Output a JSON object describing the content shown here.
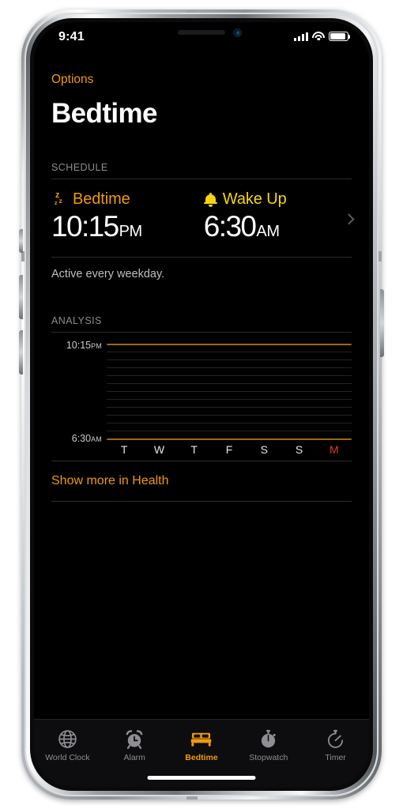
{
  "status_bar": {
    "time": "9:41",
    "signal_icon": "cellular-signal-icon",
    "wifi_icon": "wifi-icon",
    "battery_icon": "battery-full-icon"
  },
  "nav": {
    "options_label": "Options",
    "title": "Bedtime"
  },
  "schedule": {
    "header": "SCHEDULE",
    "bedtime": {
      "icon": "zzz-sleep-icon",
      "label": "Bedtime",
      "time": "10:15",
      "meridiem": "PM",
      "color": "#f09a0a"
    },
    "wakeup": {
      "icon": "bell-icon",
      "label": "Wake Up",
      "time": "6:30",
      "meridiem": "AM",
      "color": "#f7d411"
    },
    "disclosure_icon": "chevron-right-icon",
    "note": "Active every weekday."
  },
  "analysis": {
    "header": "ANALYSIS",
    "top_label_time": "10:15",
    "top_label_meridiem": "PM",
    "bottom_label_time": "6:30",
    "bottom_label_meridiem": "AM",
    "health_link": "Show more in Health"
  },
  "chart_data": {
    "type": "bar",
    "title": "ANALYSIS",
    "xlabel": "",
    "ylabel": "",
    "categories": [
      "T",
      "W",
      "T",
      "F",
      "S",
      "S",
      "M"
    ],
    "values": [
      0,
      0,
      0,
      0,
      0,
      0,
      0
    ],
    "ylim_labels": [
      "6:30 AM",
      "10:15 PM"
    ],
    "y_top_label": "10:15PM",
    "y_bottom_label": "6:30AM",
    "grid": true,
    "gridline_count": 11,
    "boundary_line_color": "#9a6a12",
    "gridline_color": "#242427",
    "today_index": 6,
    "today_color": "#e8352e",
    "legend": [],
    "notes": "No sleep data recorded; empty plot between bedtime and wake-up boundary lines."
  },
  "tabs": [
    {
      "id": "world-clock",
      "label": "World Clock",
      "icon": "globe-icon",
      "active": false
    },
    {
      "id": "alarm",
      "label": "Alarm",
      "icon": "alarm-clock-icon",
      "active": false
    },
    {
      "id": "bedtime",
      "label": "Bedtime",
      "icon": "bed-icon",
      "active": true
    },
    {
      "id": "stopwatch",
      "label": "Stopwatch",
      "icon": "stopwatch-icon",
      "active": false
    },
    {
      "id": "timer",
      "label": "Timer",
      "icon": "timer-icon",
      "active": false
    }
  ],
  "colors": {
    "accent_orange": "#f09a0a",
    "accent_yellow": "#f7d411",
    "today_red": "#e8352e",
    "background": "#000000"
  }
}
